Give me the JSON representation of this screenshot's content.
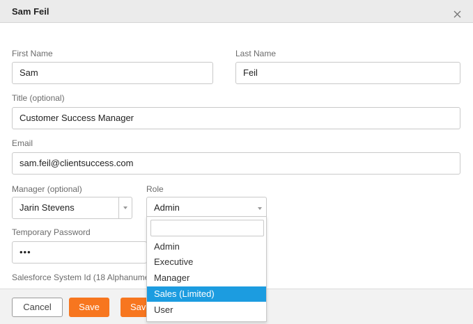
{
  "dialog": {
    "title": "Sam Feil"
  },
  "form": {
    "first_name": {
      "label": "First Name",
      "value": "Sam"
    },
    "last_name": {
      "label": "Last Name",
      "value": "Feil"
    },
    "title": {
      "label": "Title (optional)",
      "value": "Customer Success Manager"
    },
    "email": {
      "label": "Email",
      "value": "sam.feil@clientsuccess.com"
    },
    "manager": {
      "label": "Manager (optional)",
      "value": "Jarin Stevens"
    },
    "role": {
      "label": "Role",
      "value": "Admin"
    },
    "temp_password": {
      "label": "Temporary Password",
      "value": "•••"
    },
    "salesforce_id": {
      "label": "Salesforce System Id (18 Alphanume"
    }
  },
  "role_dropdown": {
    "search_value": "",
    "options": [
      {
        "label": "Admin"
      },
      {
        "label": "Executive"
      },
      {
        "label": "Manager"
      },
      {
        "label": "Sales (Limited)",
        "highlighted": true
      },
      {
        "label": "User"
      }
    ]
  },
  "footer": {
    "cancel_label": "Cancel",
    "save_label": "Save",
    "save2_label": "Save"
  },
  "colors": {
    "accent": "#f7761f",
    "highlight": "#1c9ce0"
  },
  "icons": {
    "close": "close-icon",
    "search": "search-icon",
    "caret": "chevron-down-icon"
  }
}
